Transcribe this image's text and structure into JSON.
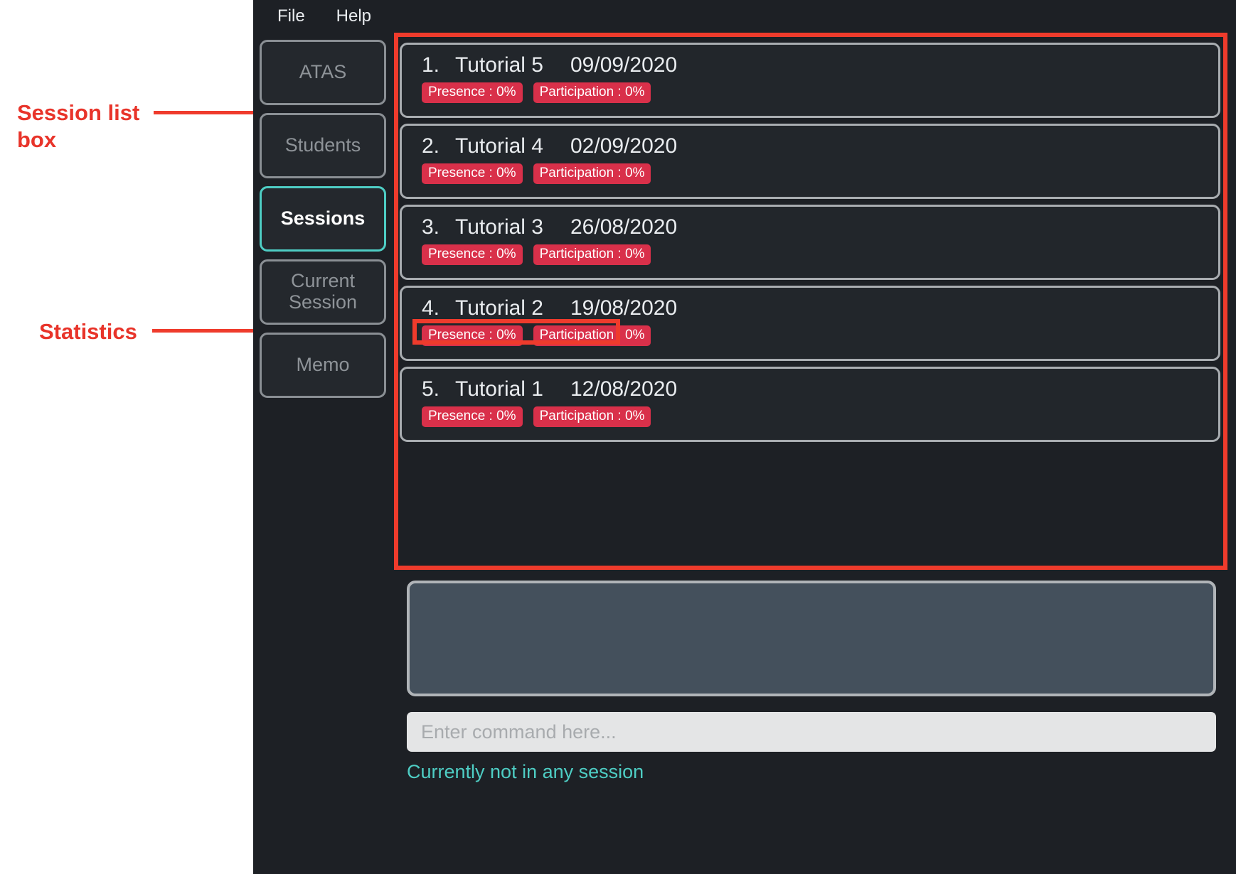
{
  "annotations": [
    {
      "id": "session-list",
      "text": "Session list\nbox"
    },
    {
      "id": "statistics",
      "text": "Statistics"
    }
  ],
  "accent_colors": {
    "annotation_red": "#ef3b2c",
    "active_teal": "#4ecdc4",
    "badge_red": "#d9304a",
    "app_background": "#1d2025",
    "card_border": "#a9adb1",
    "result_box": "#44505c"
  },
  "menubar": {
    "items": [
      {
        "label": "File"
      },
      {
        "label": "Help"
      }
    ]
  },
  "sidebar": {
    "items": [
      {
        "label": "ATAS",
        "active": false
      },
      {
        "label": "Students",
        "active": false
      },
      {
        "label": "Sessions",
        "active": true
      },
      {
        "label": "Current\nSession",
        "active": false
      },
      {
        "label": "Memo",
        "active": false
      }
    ]
  },
  "session_list": {
    "sessions": [
      {
        "index": "1.",
        "name": "Tutorial 5",
        "date": "09/09/2020",
        "presence": "Presence : 0%",
        "participation": "Participation : 0%"
      },
      {
        "index": "2.",
        "name": "Tutorial 4",
        "date": "02/09/2020",
        "presence": "Presence : 0%",
        "participation": "Participation : 0%"
      },
      {
        "index": "3.",
        "name": "Tutorial 3",
        "date": "26/08/2020",
        "presence": "Presence : 0%",
        "participation": "Participation : 0%"
      },
      {
        "index": "4.",
        "name": "Tutorial 2",
        "date": "19/08/2020",
        "presence": "Presence : 0%",
        "participation": "Participation : 0%"
      },
      {
        "index": "5.",
        "name": "Tutorial 1",
        "date": "12/08/2020",
        "presence": "Presence : 0%",
        "participation": "Participation : 0%"
      }
    ]
  },
  "result_box": {
    "text": ""
  },
  "command": {
    "value": "",
    "placeholder": "Enter command here..."
  },
  "status": {
    "text": "Currently not in any session"
  }
}
